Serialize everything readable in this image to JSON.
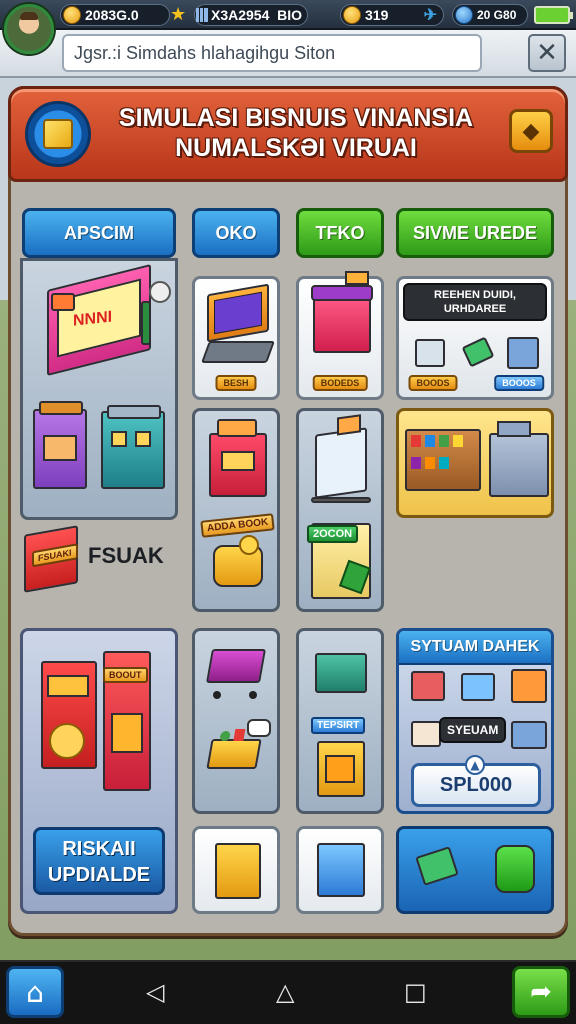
{
  "status": {
    "coins": "2083G.0",
    "gems": "X3A2954",
    "level": "BIO",
    "gold": "319",
    "diamonds": "20 G80"
  },
  "search": {
    "value": "Jgsr.:i Simdahs hlahagihgu Siton"
  },
  "banner": {
    "title": "SIMULASI BISNUIS VINANSIA NUMALSKƏI VIRUAI"
  },
  "tabs": [
    {
      "label": "APSCIM"
    },
    {
      "label": "OKO"
    },
    {
      "label": "TFKO"
    },
    {
      "label": "SIVME UREDE"
    }
  ],
  "tiles": {
    "sign_text": "NNNI",
    "laptop_price": "BESH",
    "kiosk_price": "BODEDS",
    "upgrade_popup": "REEHEN DUIDI, URHDAREE",
    "upgrade_price_left": "BOODS",
    "upgrade_price_right": "BOOOS",
    "sticker_label": "FSUAK",
    "sticker_tag": "FSUAKI",
    "register_tag": "ADDA BOOK",
    "cash_label": "2OCON",
    "shelf_tag": "TEPSIRT",
    "store_panel_title": "SYTUAM DAHEK",
    "store_panel_tooltip": "SYEUAM",
    "store_panel_button": "SPL000",
    "risk_button": "RISKAII UPDIALDE",
    "stand_sign": "BOOUT"
  },
  "colors": {
    "accent_blue": "#1b6fc2",
    "accent_green": "#2e9a17",
    "banner_red": "#c8431f",
    "gold": "#e89b1f"
  },
  "icons": [
    "coin-icon",
    "star-icon",
    "gem-icon",
    "bird-icon",
    "close-icon",
    "home-icon",
    "back-icon",
    "circle-home-icon",
    "recents-icon",
    "share-icon"
  ]
}
